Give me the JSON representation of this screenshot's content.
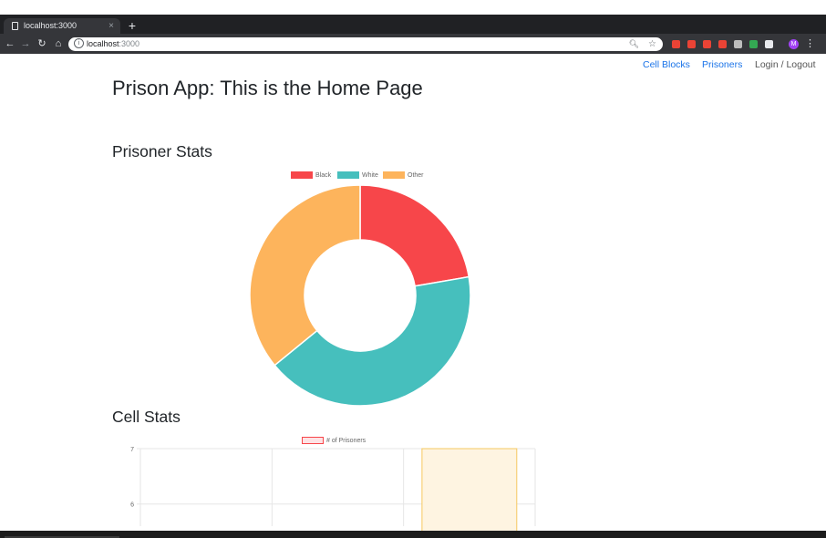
{
  "browser": {
    "tab_title": "localhost:3000",
    "tab_close": "×",
    "new_tab": "+",
    "url_host": "localhost",
    "url_port": ":3000",
    "info_glyph": "i",
    "zoom_icon": "zoom-icon",
    "bookmark_icon": "star-icon",
    "back_glyph": "←",
    "forward_glyph": "→",
    "reload_glyph": "↻",
    "home_glyph": "⌂",
    "menu_glyph": "⋮",
    "profile_initial": "M",
    "extension_colors": [
      "#ea4335",
      "#ea4335",
      "#ea4335",
      "#ea4335",
      "#bdbdbd",
      "#34a853",
      "#e8eaed",
      "#a142f4"
    ]
  },
  "nav": {
    "cell_blocks": "Cell Blocks",
    "prisoners": "Prisoners",
    "login_logout": "Login / Logout"
  },
  "page": {
    "title": "Prison App: This is the Home Page",
    "prisoner_stats_heading": "Prisoner Stats",
    "cell_stats_heading": "Cell Stats"
  },
  "chart_data": [
    {
      "type": "pie",
      "variant": "doughnut",
      "labels": [
        "Black",
        "White",
        "Other"
      ],
      "values": [
        22.3,
        41.8,
        35.9
      ],
      "colors": [
        "#f7464a",
        "#46bfbd",
        "#fdb45c"
      ],
      "legend": "top"
    },
    {
      "type": "bar",
      "series": [
        {
          "name": "# of Prisoners",
          "values": [
            null,
            null,
            7
          ]
        }
      ],
      "categories": [
        "",
        "",
        ""
      ],
      "ylim": [
        5.6,
        7
      ],
      "yticks": [
        6,
        7
      ],
      "series_colors": {
        "fill": "#fef4e1",
        "border": "#f6c85f",
        "legend_fill": "#fde2e4",
        "legend_border": "#f7464a"
      },
      "grid": true,
      "legend": "top"
    }
  ]
}
